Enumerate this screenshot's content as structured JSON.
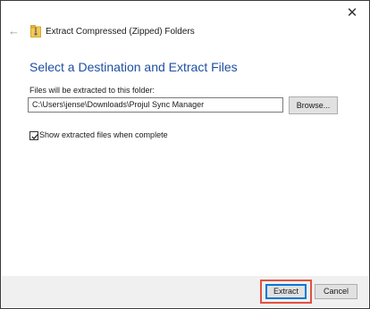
{
  "window": {
    "close_glyph": "✕"
  },
  "header": {
    "back_glyph": "←",
    "icon": "zip-folder-icon",
    "title": "Extract Compressed (Zipped) Folders"
  },
  "main": {
    "page_title": "Select a Destination and Extract Files",
    "path_label": "Files will be extracted to this folder:",
    "path_value": "C:\\Users\\jense\\Downloads\\Projul Sync Manager",
    "browse_label": "Browse...",
    "show_files_checked": true,
    "show_files_label": "Show extracted files when complete"
  },
  "footer": {
    "extract_label": "Extract",
    "cancel_label": "Cancel"
  },
  "colors": {
    "title_blue": "#1f4fa0",
    "highlight_red": "#e2513f",
    "focus_blue": "#0078d7",
    "footer_bg": "#f0f0f0"
  }
}
